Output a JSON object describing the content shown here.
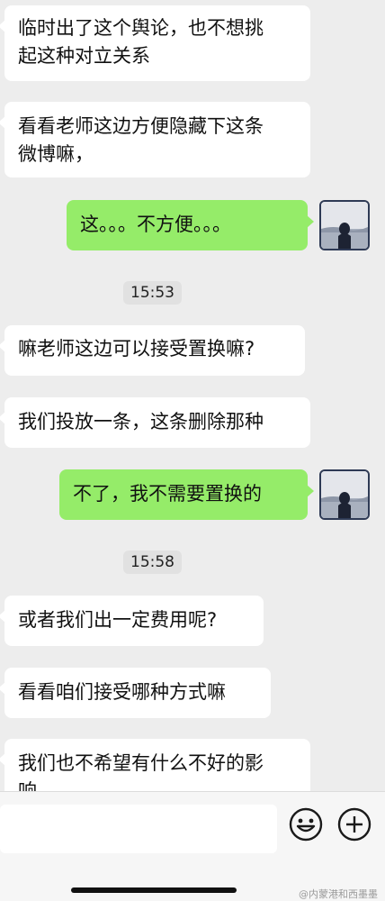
{
  "messages": [
    {
      "side": "in",
      "text": "临时出了这个舆论，也不想挑\n起这种对立关系"
    },
    {
      "side": "in",
      "text": "看看老师这边方便隐藏下这条\n微博嘛，"
    },
    {
      "side": "out",
      "text": "这。。。不方便。。。"
    },
    {
      "side": "time",
      "text": "15:53"
    },
    {
      "side": "in",
      "text": "嘛老师这边可以接受置换嘛?"
    },
    {
      "side": "in",
      "text": "我们投放一条，这条删除那种"
    },
    {
      "side": "out",
      "text": "不了，我不需要置换的"
    },
    {
      "side": "time",
      "text": "15:58"
    },
    {
      "side": "in",
      "text": "或者我们出一定费用呢?"
    },
    {
      "side": "in",
      "text": "看看咱们接受哪种方式嘛"
    },
    {
      "side": "in",
      "text": "我们也不希望有什么不好的影\n响，"
    }
  ],
  "input_bar": {
    "emoji_icon": "emoji-icon",
    "plus_icon": "plus-icon"
  },
  "watermark": "@内蒙港和西墨墨"
}
